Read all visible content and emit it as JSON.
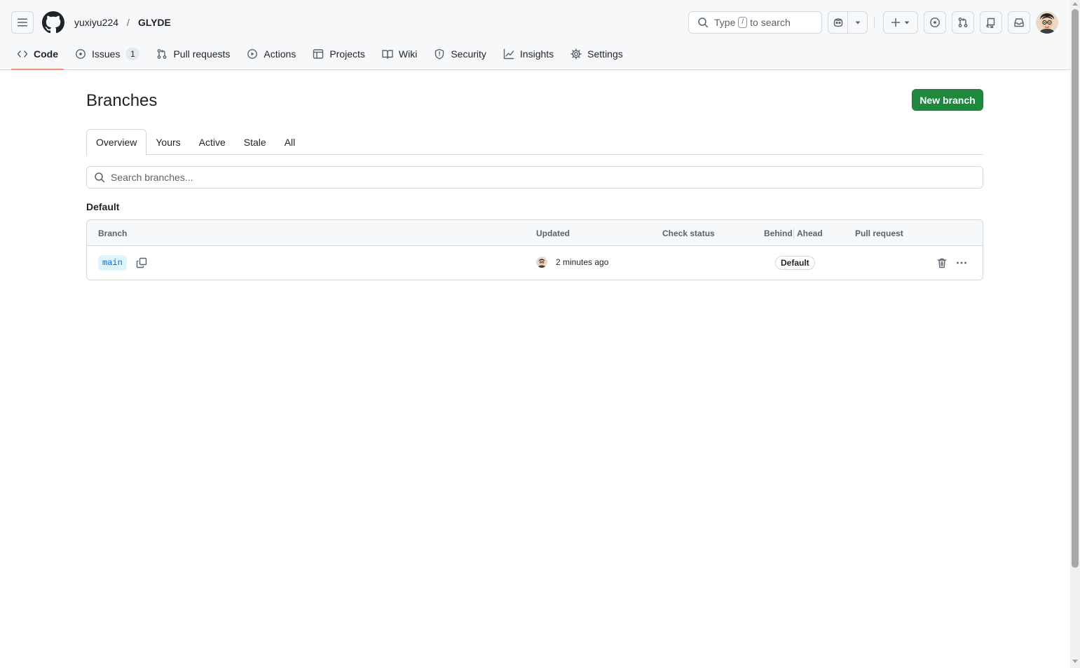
{
  "header": {
    "owner": "yuxiyu224",
    "separator": "/",
    "repo": "GLYDE",
    "search_prefix": "Type",
    "search_key": "/",
    "search_suffix": "to search"
  },
  "nav": {
    "code": "Code",
    "issues": "Issues",
    "issues_count": "1",
    "pull_requests": "Pull requests",
    "actions": "Actions",
    "projects": "Projects",
    "wiki": "Wiki",
    "security": "Security",
    "insights": "Insights",
    "settings": "Settings"
  },
  "page": {
    "title": "Branches",
    "new_branch": "New branch"
  },
  "tabs": {
    "overview": "Overview",
    "yours": "Yours",
    "active": "Active",
    "stale": "Stale",
    "all": "All"
  },
  "search": {
    "placeholder": "Search branches..."
  },
  "section": {
    "default_title": "Default"
  },
  "table": {
    "columns": {
      "branch": "Branch",
      "updated": "Updated",
      "check_status": "Check status",
      "behind": "Behind",
      "ahead": "Ahead",
      "pull_request": "Pull request"
    },
    "rows": [
      {
        "branch": "main",
        "updated": "2 minutes ago",
        "label": "Default"
      }
    ]
  },
  "colors": {
    "primary_button": "#1f883d",
    "nav_underline": "#fd8c73",
    "branch_badge_bg": "#ddf4ff",
    "branch_badge_text": "#0969da"
  }
}
